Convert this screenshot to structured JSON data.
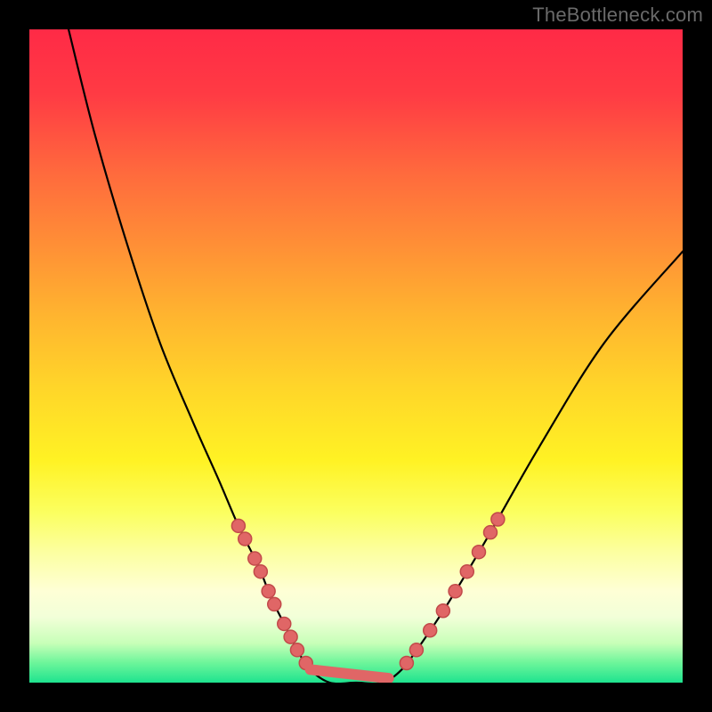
{
  "watermark": "TheBottleneck.com",
  "chart_data": {
    "type": "line",
    "title": "",
    "xlabel": "",
    "ylabel": "",
    "xlim": [
      0,
      100
    ],
    "ylim": [
      0,
      100
    ],
    "series": [
      {
        "name": "curve",
        "x": [
          6,
          10,
          15,
          20,
          25,
          29,
          32,
          35,
          37,
          39,
          41,
          43,
          46,
          50,
          54,
          57,
          60,
          64,
          70,
          78,
          88,
          100
        ],
        "values": [
          100,
          84,
          67,
          52,
          40,
          31,
          24,
          18,
          13,
          9,
          5,
          2,
          0,
          0,
          0,
          2,
          6,
          12,
          22,
          36,
          52,
          66
        ]
      }
    ],
    "highlight_points": {
      "left_branch_y": [
        24,
        22,
        19,
        17,
        14,
        12,
        9,
        7,
        5,
        3
      ],
      "right_branch_y": [
        3,
        5,
        8,
        11,
        14,
        17,
        20,
        23,
        25
      ],
      "bottom_flat_x": [
        43,
        55
      ]
    },
    "colors": {
      "curve": "#000000",
      "dots": "#e06666",
      "gradient_top": "#ff2a46",
      "gradient_mid": "#fff224",
      "gradient_bottom": "#1ee38f",
      "frame": "#000000"
    }
  }
}
